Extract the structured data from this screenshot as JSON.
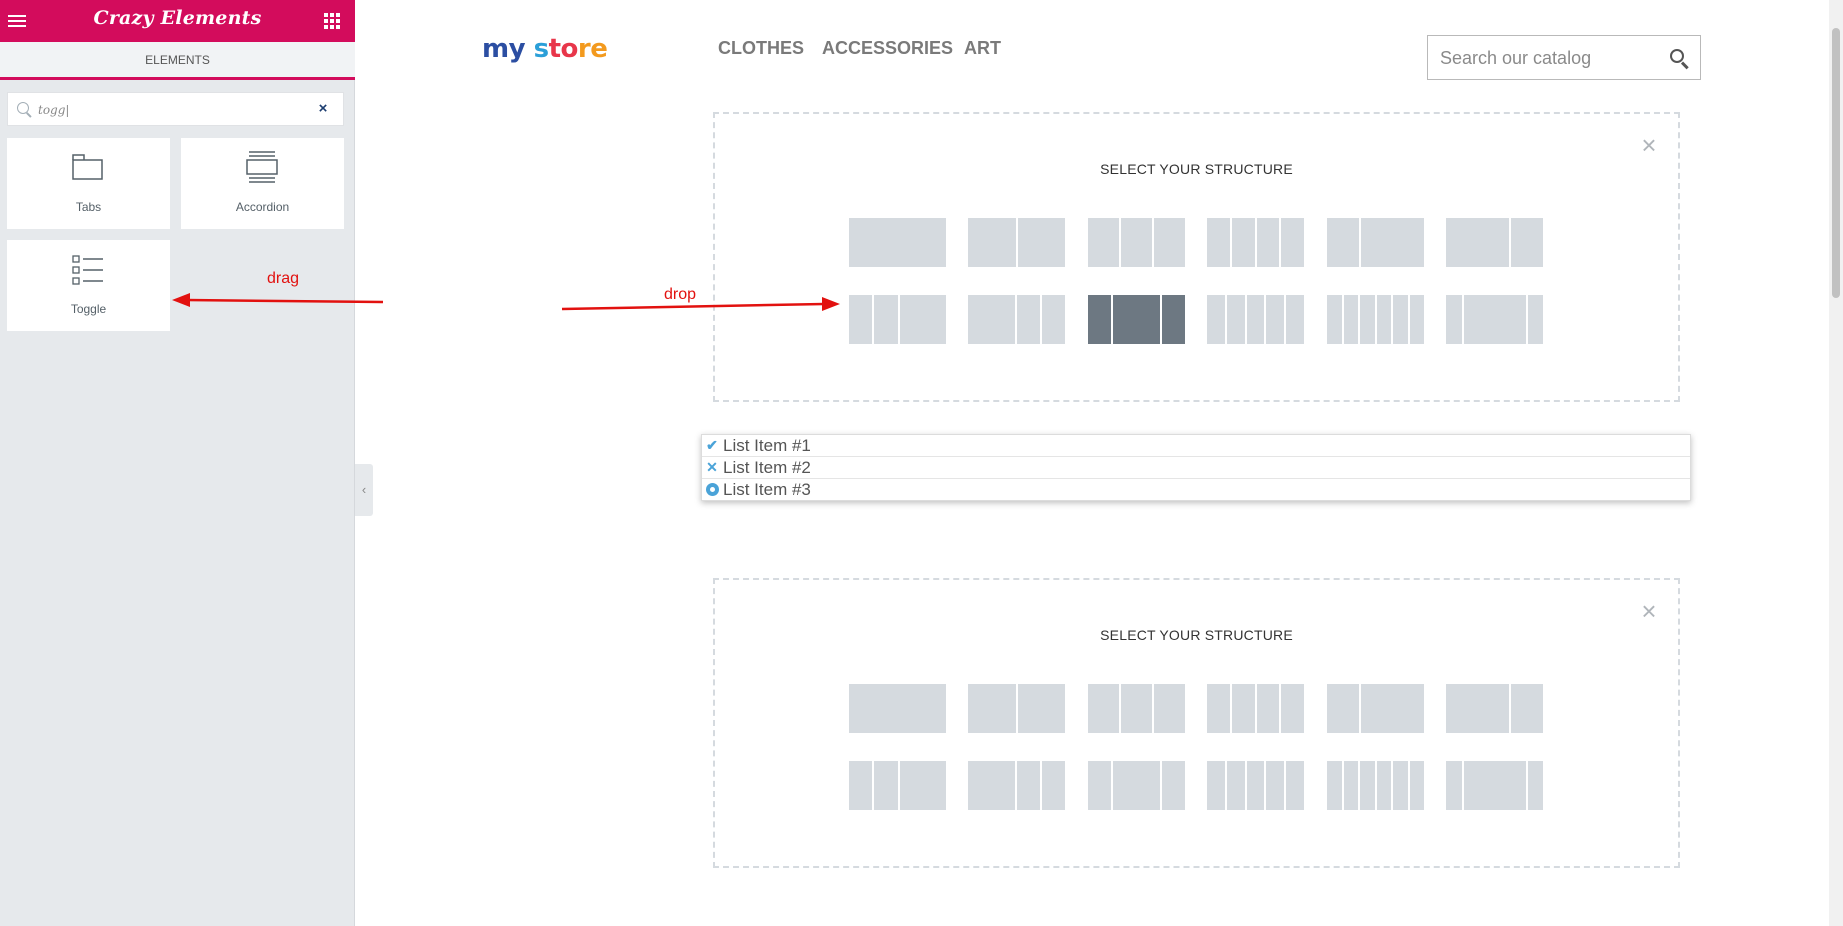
{
  "panel": {
    "title": "Crazy Elements",
    "tab_label": "ELEMENTS",
    "search_value": "togg|",
    "clear_symbol": "×",
    "widgets": [
      {
        "label": "Tabs",
        "icon": "tabs-icon"
      },
      {
        "label": "Accordion",
        "icon": "accordion-icon"
      },
      {
        "label": "Toggle",
        "icon": "toggle-icon"
      }
    ],
    "collapse_symbol": "‹"
  },
  "site": {
    "logo": [
      "my",
      " s",
      "to",
      "re"
    ],
    "nav": [
      "CLOTHES",
      "ACCESSORIES",
      "ART"
    ],
    "search_placeholder": "Search our catalog"
  },
  "structures": [
    {
      "title": "SELECT YOUR STRUCTURE",
      "close_symbol": "×"
    },
    {
      "title": "SELECT YOUR STRUCTURE",
      "close_symbol": "×"
    }
  ],
  "list_items": [
    {
      "icon": "check-icon",
      "glyph": "✔",
      "text": "List Item #1"
    },
    {
      "icon": "times-icon",
      "glyph": "✕",
      "text": "List Item #2"
    },
    {
      "icon": "dot-circle-icon",
      "glyph": "",
      "text": "List Item #3"
    }
  ],
  "annotations": {
    "drag": "drag",
    "drop": "drop",
    "color": "#e2110f"
  },
  "colors": {
    "brand": "#d30c5c",
    "preset_fill": "#d5dadf",
    "preset_active": "#6d7882",
    "list_icon": "#4aa3d8"
  }
}
